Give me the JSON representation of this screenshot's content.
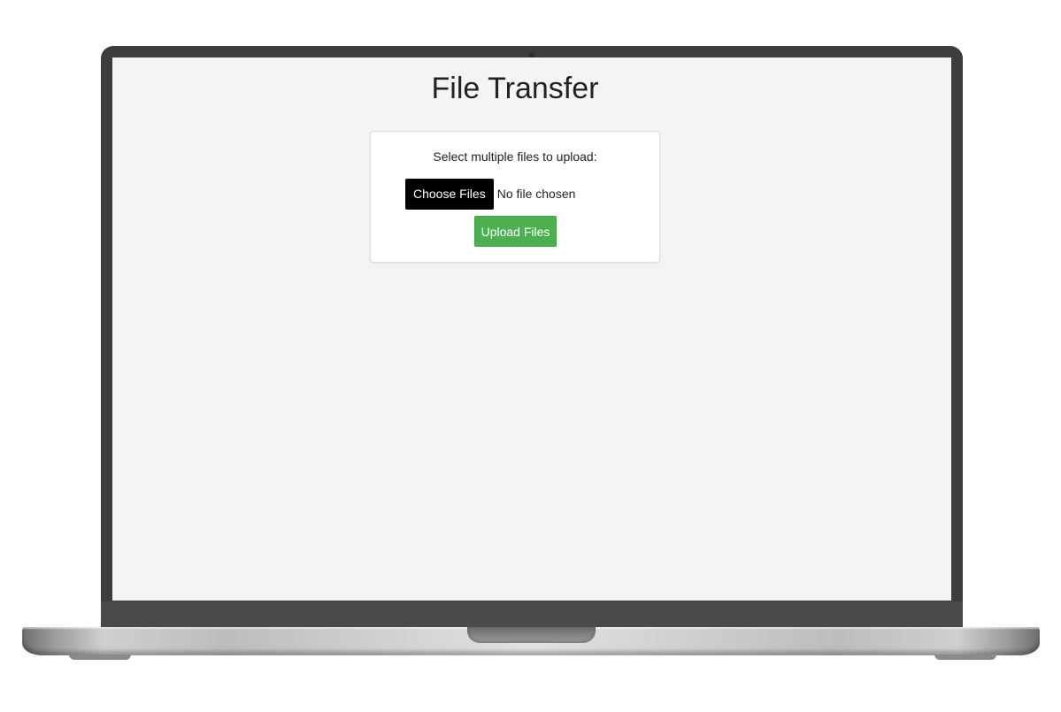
{
  "page": {
    "title": "File Transfer"
  },
  "upload_form": {
    "label": "Select multiple files to upload:",
    "choose_files_label": "Choose Files",
    "file_status": "No file chosen",
    "upload_label": "Upload Files"
  },
  "colors": {
    "upload_button": "#4caf50",
    "choose_button": "#000000",
    "page_background": "#f4f4f4",
    "bezel": "#3d3d3b"
  }
}
